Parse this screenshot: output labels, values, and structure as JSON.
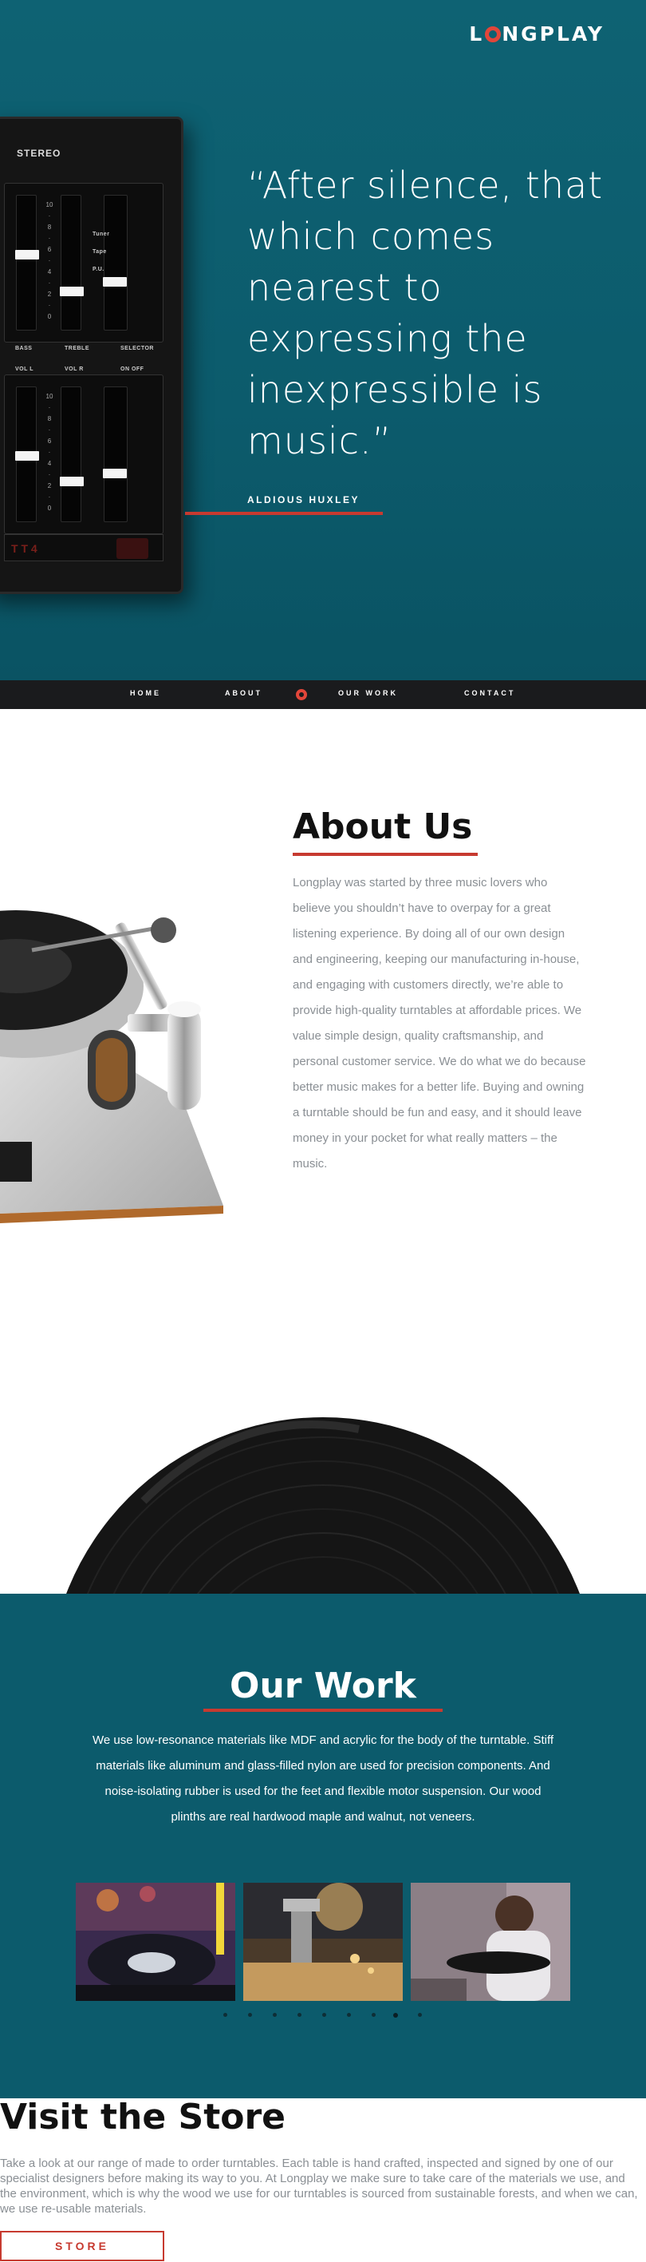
{
  "brand": {
    "logo_pre": "L",
    "logo_post": "NGPLAY"
  },
  "hero": {
    "quote": "“After silence, that which comes nearest to expressing the inexpressible is music.”",
    "author": "ALDIOUS HUXLEY",
    "mixer": {
      "label": "STEREO",
      "scale_marks": [
        "10",
        "8",
        "6",
        "4",
        "2",
        "0"
      ],
      "top_selector_labels": [
        "Tuner",
        "Tape",
        "P.U."
      ],
      "top_labels": [
        "BASS",
        "TREBLE",
        "SELECTOR"
      ],
      "bottom_labels": [
        "VOL L",
        "VOL R",
        "ON OFF"
      ],
      "badge": "T T 4"
    }
  },
  "nav": {
    "items": [
      {
        "label": "HOME"
      },
      {
        "label": "ABOUT"
      },
      {
        "label": "OUR WORK"
      },
      {
        "label": "CONTACT"
      }
    ]
  },
  "about": {
    "title": "About Us",
    "body": "Longplay was started by three music lovers who believe you shouldn’t have to overpay for a great listening experience. By doing all of our own design and engineering, keeping our manufacturing in-house, and engaging with customers directly, we’re able to provide high-quality turntables at affordable prices. We value simple design, quality craftsmanship, and personal customer service. We do what we do because better music makes for a better life. Buying and owning a turntable should be fun and easy, and it should leave money in your pocket for what really matters – the music."
  },
  "work": {
    "title": "Our Work",
    "body": "We use low-resonance materials like MDF and acrylic for the body of the turntable. Stiff materials like aluminum and glass-filled nylon are used for precision components. And noise-isolating rubber is used for the feet and flexible motor suspension. Our wood plinths are real hardwood maple and walnut, not veneers.",
    "carousel": {
      "dot_count": 9,
      "active_index": 7
    }
  },
  "store": {
    "title": "Visit the Store",
    "body": "Take a look at our range of made to order turntables. Each table is hand crafted, inspected and signed by one of our specialist designers before making its way to you. At Longplay we make sure to take care of the materials we use, and the environment, which is why the wood we use for our turntables is sourced from sustainable forests, and when we can, we use re-usable materials.",
    "button_label": "STORE"
  },
  "colors": {
    "teal": "#0c5b6c",
    "accent_red": "#c73a30",
    "logo_red": "#e2463a",
    "nav_dark": "#1a1b1d",
    "body_gray": "#8a8f94"
  }
}
